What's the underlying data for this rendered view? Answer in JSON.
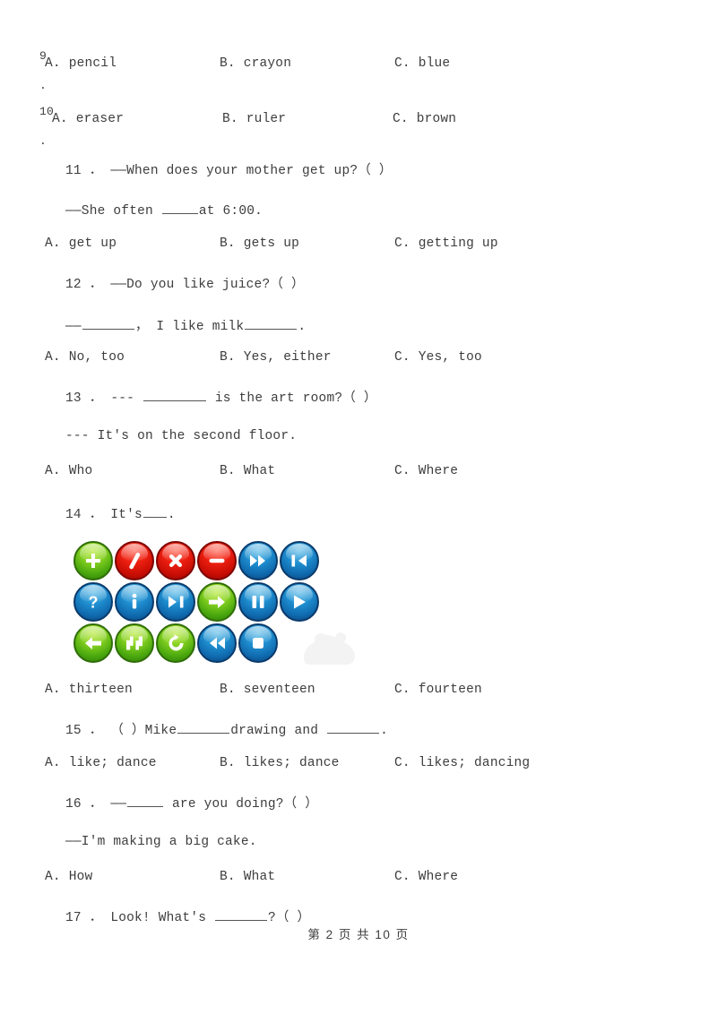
{
  "document": {
    "type": "english-exam-multiple-choice",
    "footer": "第 2 页 共 10 页"
  },
  "questions": [
    {
      "number": "9",
      "number_dot": ".",
      "stem": "",
      "options": {
        "a": "A. pencil",
        "b": "B. crayon",
        "c": "C. blue"
      }
    },
    {
      "number": "10",
      "number_dot": ".",
      "stem": "",
      "options": {
        "a": "A. eraser",
        "b": "B. ruler",
        "c": "C. brown"
      }
    },
    {
      "number": "11",
      "stem_prefix": "11 ． ",
      "stem": "——When does your mother get up?（    ）",
      "stem_line2_pre": "——She often ",
      "stem_line2_post": "at 6:00.",
      "options": {
        "a": "A. get up",
        "b": "B. gets up",
        "c": "C. getting up"
      }
    },
    {
      "number": "12",
      "stem_prefix": "12 ． ",
      "stem": "——Do you like juice?（    ）",
      "stem_line2_pre": "——",
      "stem_line2_mid": "， I like milk",
      "stem_line2_post": ".",
      "options": {
        "a": "A. No, too",
        "b": "B. Yes, either",
        "c": "C. Yes, too"
      }
    },
    {
      "number": "13",
      "stem_prefix": "13 ． ",
      "stem_pre": "--- ",
      "stem_post": " is the art room?（    ）",
      "stem_line2": "--- It's on the second floor.",
      "options": {
        "a": "A. Who",
        "b": "B. What",
        "c": "C. Where"
      }
    },
    {
      "number": "14",
      "stem_prefix": "14 ． ",
      "stem_pre": "It's",
      "stem_post": ".",
      "options": {
        "a": "A. thirteen",
        "b": "B. seventeen",
        "c": "C. fourteen"
      }
    },
    {
      "number": "15",
      "stem_prefix": "15 ． ",
      "stem_pre": "（    ）Mike",
      "stem_mid": "drawing and ",
      "stem_post": ".",
      "options": {
        "a": "A. like; dance",
        "b": "B. likes; dance",
        "c": "C. likes; dancing"
      }
    },
    {
      "number": "16",
      "stem_prefix": "16 ． ",
      "stem_pre": "——",
      "stem_post": " are you doing?（    ）",
      "stem_line2": "——I'm making a big cake.",
      "options": {
        "a": "A. How",
        "b": "B. What",
        "c": "C. Where"
      }
    },
    {
      "number": "17",
      "stem_prefix": "17 ． ",
      "stem_pre": "Look! What's ",
      "stem_post": "?（    ）"
    }
  ],
  "figure": {
    "caption": "glossy round button icon set",
    "rows": [
      [
        {
          "icon": "plus-icon",
          "color": "#7bc814",
          "tone": "green"
        },
        {
          "icon": "slash-icon",
          "color": "#e01b0d",
          "tone": "red"
        },
        {
          "icon": "close-x-icon",
          "color": "#e01b0d",
          "tone": "red"
        },
        {
          "icon": "minus-icon",
          "color": "#e01b0d",
          "tone": "red"
        },
        {
          "icon": "fast-forward-icon",
          "color": "#1f8fd0",
          "tone": "blue"
        },
        {
          "icon": "skip-previous-icon",
          "color": "#1f8fd0",
          "tone": "blue"
        }
      ],
      [
        {
          "icon": "question-mark-icon",
          "color": "#1f8fd0",
          "tone": "blue"
        },
        {
          "icon": "info-icon",
          "color": "#1f8fd0",
          "tone": "blue"
        },
        {
          "icon": "skip-next-icon",
          "color": "#1f8fd0",
          "tone": "blue"
        },
        {
          "icon": "arrow-right-icon",
          "color": "#7bc814",
          "tone": "green"
        },
        {
          "icon": "pause-icon",
          "color": "#1f8fd0",
          "tone": "blue"
        },
        {
          "icon": "play-icon",
          "color": "#1f8fd0",
          "tone": "blue"
        }
      ],
      [
        {
          "icon": "arrow-left-icon",
          "color": "#7bc814",
          "tone": "green"
        },
        {
          "icon": "sync-icon",
          "color": "#7bc814",
          "tone": "green"
        },
        {
          "icon": "redo-icon",
          "color": "#7bc814",
          "tone": "green"
        },
        {
          "icon": "rewind-icon",
          "color": "#1f8fd0",
          "tone": "blue"
        },
        {
          "icon": "stop-icon",
          "color": "#1f8fd0",
          "tone": "blue"
        }
      ]
    ]
  }
}
